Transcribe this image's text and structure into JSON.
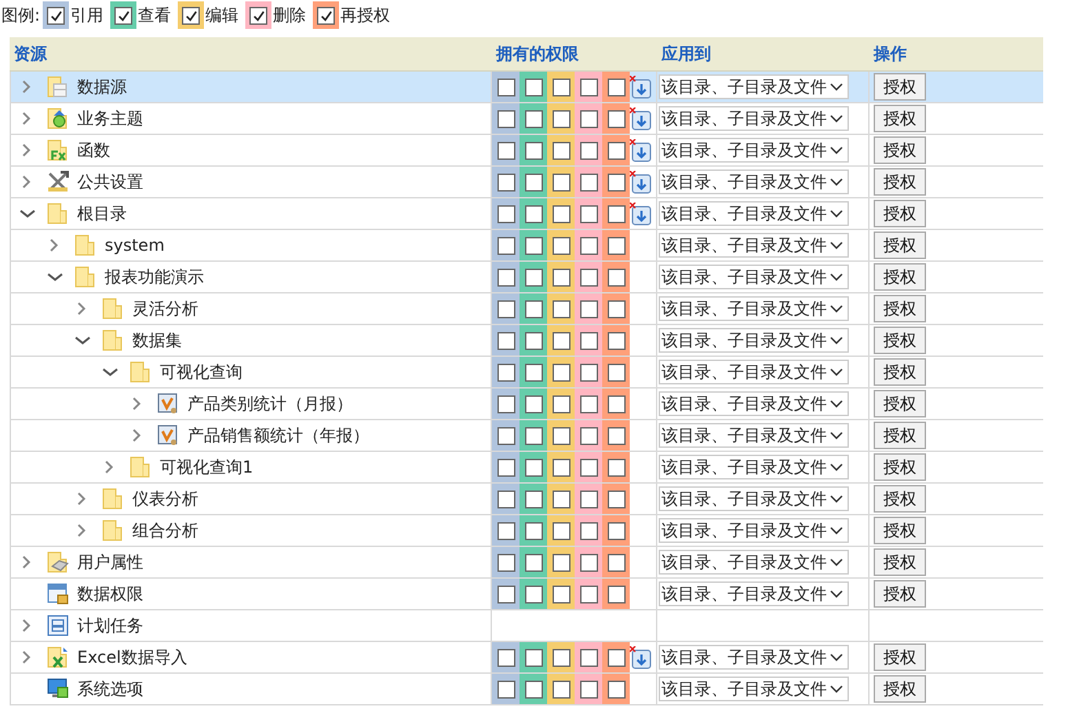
{
  "legend": {
    "label": "图例:",
    "items": [
      {
        "label": "引用",
        "color": "#b0c4de",
        "checked": true
      },
      {
        "label": "查看",
        "color": "#66cdaa",
        "checked": true
      },
      {
        "label": "编辑",
        "color": "#f5cd6e",
        "checked": true
      },
      {
        "label": "删除",
        "color": "#ffb6c1",
        "checked": true
      },
      {
        "label": "再授权",
        "color": "#ffa07a",
        "checked": true
      }
    ]
  },
  "table": {
    "columns": [
      "资源",
      "拥有的权限",
      "应用到",
      "操作"
    ],
    "rows": [
      {
        "label": "数据源",
        "kind": "datasource",
        "expanded": false,
        "selected": true,
        "inherit": true,
        "perms": [
          {
            "checked": false
          },
          {
            "checked": false
          },
          {
            "checked": false
          },
          {
            "checked": false
          },
          {
            "checked": false
          }
        ],
        "apply_to": "该目录、子目录及文件",
        "action": "授权"
      },
      {
        "label": "业务主题",
        "kind": "subject",
        "expanded": false,
        "selected": false,
        "inherit": true,
        "perms": [
          {
            "checked": false
          },
          {
            "checked": false
          },
          {
            "checked": false
          },
          {
            "checked": false
          },
          {
            "checked": false
          }
        ],
        "apply_to": "该目录、子目录及文件",
        "action": "授权"
      },
      {
        "label": "函数",
        "kind": "function",
        "expanded": false,
        "selected": false,
        "inherit": true,
        "perms": [
          {
            "checked": false
          },
          {
            "checked": false
          },
          {
            "checked": false
          },
          {
            "checked": false
          },
          {
            "checked": false
          }
        ],
        "apply_to": "该目录、子目录及文件",
        "action": "授权"
      },
      {
        "label": "公共设置",
        "kind": "tools",
        "expanded": false,
        "selected": false,
        "inherit": true,
        "perms": [
          {
            "checked": false
          },
          {
            "checked": false
          },
          {
            "checked": false
          },
          {
            "checked": false
          },
          {
            "checked": false
          }
        ],
        "apply_to": "该目录、子目录及文件",
        "action": "授权"
      },
      {
        "label": "根目录",
        "kind": "folder",
        "expanded": true,
        "selected": false,
        "inherit": true,
        "perms": [
          {
            "checked": false
          },
          {
            "checked": false
          },
          {
            "checked": false
          },
          {
            "checked": false
          },
          {
            "checked": false
          }
        ],
        "apply_to": "该目录、子目录及文件",
        "action": "授权",
        "children": [
          {
            "label": "system",
            "kind": "folder",
            "expanded": false,
            "selected": false,
            "inherit": false,
            "perms": [
              {
                "checked": false
              },
              {
                "checked": false
              },
              {
                "checked": false
              },
              {
                "checked": false
              },
              {
                "checked": false
              }
            ],
            "apply_to": "该目录、子目录及文件",
            "action": "授权"
          },
          {
            "label": "报表功能演示",
            "kind": "folder",
            "expanded": true,
            "selected": false,
            "inherit": false,
            "perms": [
              {
                "checked": false
              },
              {
                "checked": false
              },
              {
                "checked": false
              },
              {
                "checked": false
              },
              {
                "checked": false
              }
            ],
            "apply_to": "该目录、子目录及文件",
            "action": "授权",
            "children": [
              {
                "label": "灵活分析",
                "kind": "folder",
                "expanded": false,
                "selected": false,
                "inherit": false,
                "perms": [
                  {
                    "checked": false
                  },
                  {
                    "checked": false
                  },
                  {
                    "checked": false
                  },
                  {
                    "checked": false
                  },
                  {
                    "checked": false
                  }
                ],
                "apply_to": "该目录、子目录及文件",
                "action": "授权"
              },
              {
                "label": "数据集",
                "kind": "folder",
                "expanded": true,
                "selected": false,
                "inherit": false,
                "perms": [
                  {
                    "checked": false
                  },
                  {
                    "checked": false
                  },
                  {
                    "checked": false
                  },
                  {
                    "checked": false
                  },
                  {
                    "checked": false
                  }
                ],
                "apply_to": "该目录、子目录及文件",
                "action": "授权",
                "children": [
                  {
                    "label": "可视化查询",
                    "kind": "folder",
                    "expanded": true,
                    "selected": false,
                    "inherit": false,
                    "perms": [
                      {
                        "checked": false
                      },
                      {
                        "checked": false
                      },
                      {
                        "checked": false
                      },
                      {
                        "checked": false
                      },
                      {
                        "checked": false
                      }
                    ],
                    "apply_to": "该目录、子目录及文件",
                    "action": "授权",
                    "children": [
                      {
                        "label": "产品类别统计（月报）",
                        "kind": "report",
                        "expanded": false,
                        "selected": false,
                        "inherit": false,
                        "perms": [
                          {
                            "checked": false
                          },
                          {
                            "checked": false
                          },
                          {
                            "checked": false
                          },
                          {
                            "checked": false
                          },
                          {
                            "checked": false
                          }
                        ],
                        "apply_to": "该目录、子目录及文件",
                        "action": "授权"
                      },
                      {
                        "label": "产品销售额统计（年报）",
                        "kind": "report",
                        "expanded": false,
                        "selected": false,
                        "inherit": false,
                        "perms": [
                          {
                            "checked": false
                          },
                          {
                            "checked": false
                          },
                          {
                            "checked": false
                          },
                          {
                            "checked": false
                          },
                          {
                            "checked": false
                          }
                        ],
                        "apply_to": "该目录、子目录及文件",
                        "action": "授权"
                      }
                    ]
                  },
                  {
                    "label": "可视化查询1",
                    "kind": "folder",
                    "expanded": false,
                    "selected": false,
                    "inherit": false,
                    "perms": [
                      {
                        "checked": false
                      },
                      {
                        "checked": false
                      },
                      {
                        "checked": false
                      },
                      {
                        "checked": false
                      },
                      {
                        "checked": false
                      }
                    ],
                    "apply_to": "该目录、子目录及文件",
                    "action": "授权"
                  }
                ]
              },
              {
                "label": "仪表分析",
                "kind": "folder",
                "expanded": false,
                "selected": false,
                "inherit": false,
                "perms": [
                  {
                    "checked": false
                  },
                  {
                    "checked": false
                  },
                  {
                    "checked": false
                  },
                  {
                    "checked": false
                  },
                  {
                    "checked": false
                  }
                ],
                "apply_to": "该目录、子目录及文件",
                "action": "授权"
              },
              {
                "label": "组合分析",
                "kind": "folder",
                "expanded": false,
                "selected": false,
                "inherit": false,
                "perms": [
                  {
                    "checked": false
                  },
                  {
                    "checked": false
                  },
                  {
                    "checked": false
                  },
                  {
                    "checked": false
                  },
                  {
                    "checked": false
                  }
                ],
                "apply_to": "该目录、子目录及文件",
                "action": "授权"
              }
            ]
          }
        ]
      },
      {
        "label": "用户属性",
        "kind": "user-attr",
        "expanded": false,
        "selected": false,
        "inherit": false,
        "perms": [
          {
            "checked": false
          },
          {
            "checked": false
          },
          {
            "checked": false
          },
          {
            "checked": false
          },
          {
            "checked": false
          }
        ],
        "apply_to": "该目录、子目录及文件",
        "action": "授权"
      },
      {
        "label": "数据权限",
        "kind": "data-lock",
        "selected": false,
        "inherit": false,
        "perms": [
          {
            "checked": false
          },
          {
            "checked": false
          },
          {
            "checked": false
          },
          {
            "checked": false
          },
          {
            "checked": false
          }
        ],
        "apply_to": "该目录、子目录及文件",
        "action": "授权"
      },
      {
        "label": "计划任务",
        "kind": "schedule",
        "expanded": false,
        "selected": false,
        "inherit": false
      },
      {
        "label": "Excel数据导入",
        "kind": "excel",
        "expanded": false,
        "selected": false,
        "inherit": true,
        "perms": [
          {
            "checked": false
          },
          {
            "checked": false
          },
          {
            "checked": false
          },
          {
            "checked": false
          },
          {
            "checked": false
          }
        ],
        "apply_to": "该目录、子目录及文件",
        "action": "授权"
      },
      {
        "label": "系统选项",
        "kind": "system",
        "selected": false,
        "inherit": false,
        "perms": [
          {
            "checked": false
          },
          {
            "checked": false
          },
          {
            "checked": false
          },
          {
            "checked": false
          },
          {
            "checked": false
          }
        ],
        "apply_to": "该目录、子目录及文件",
        "action": "授权"
      }
    ]
  }
}
